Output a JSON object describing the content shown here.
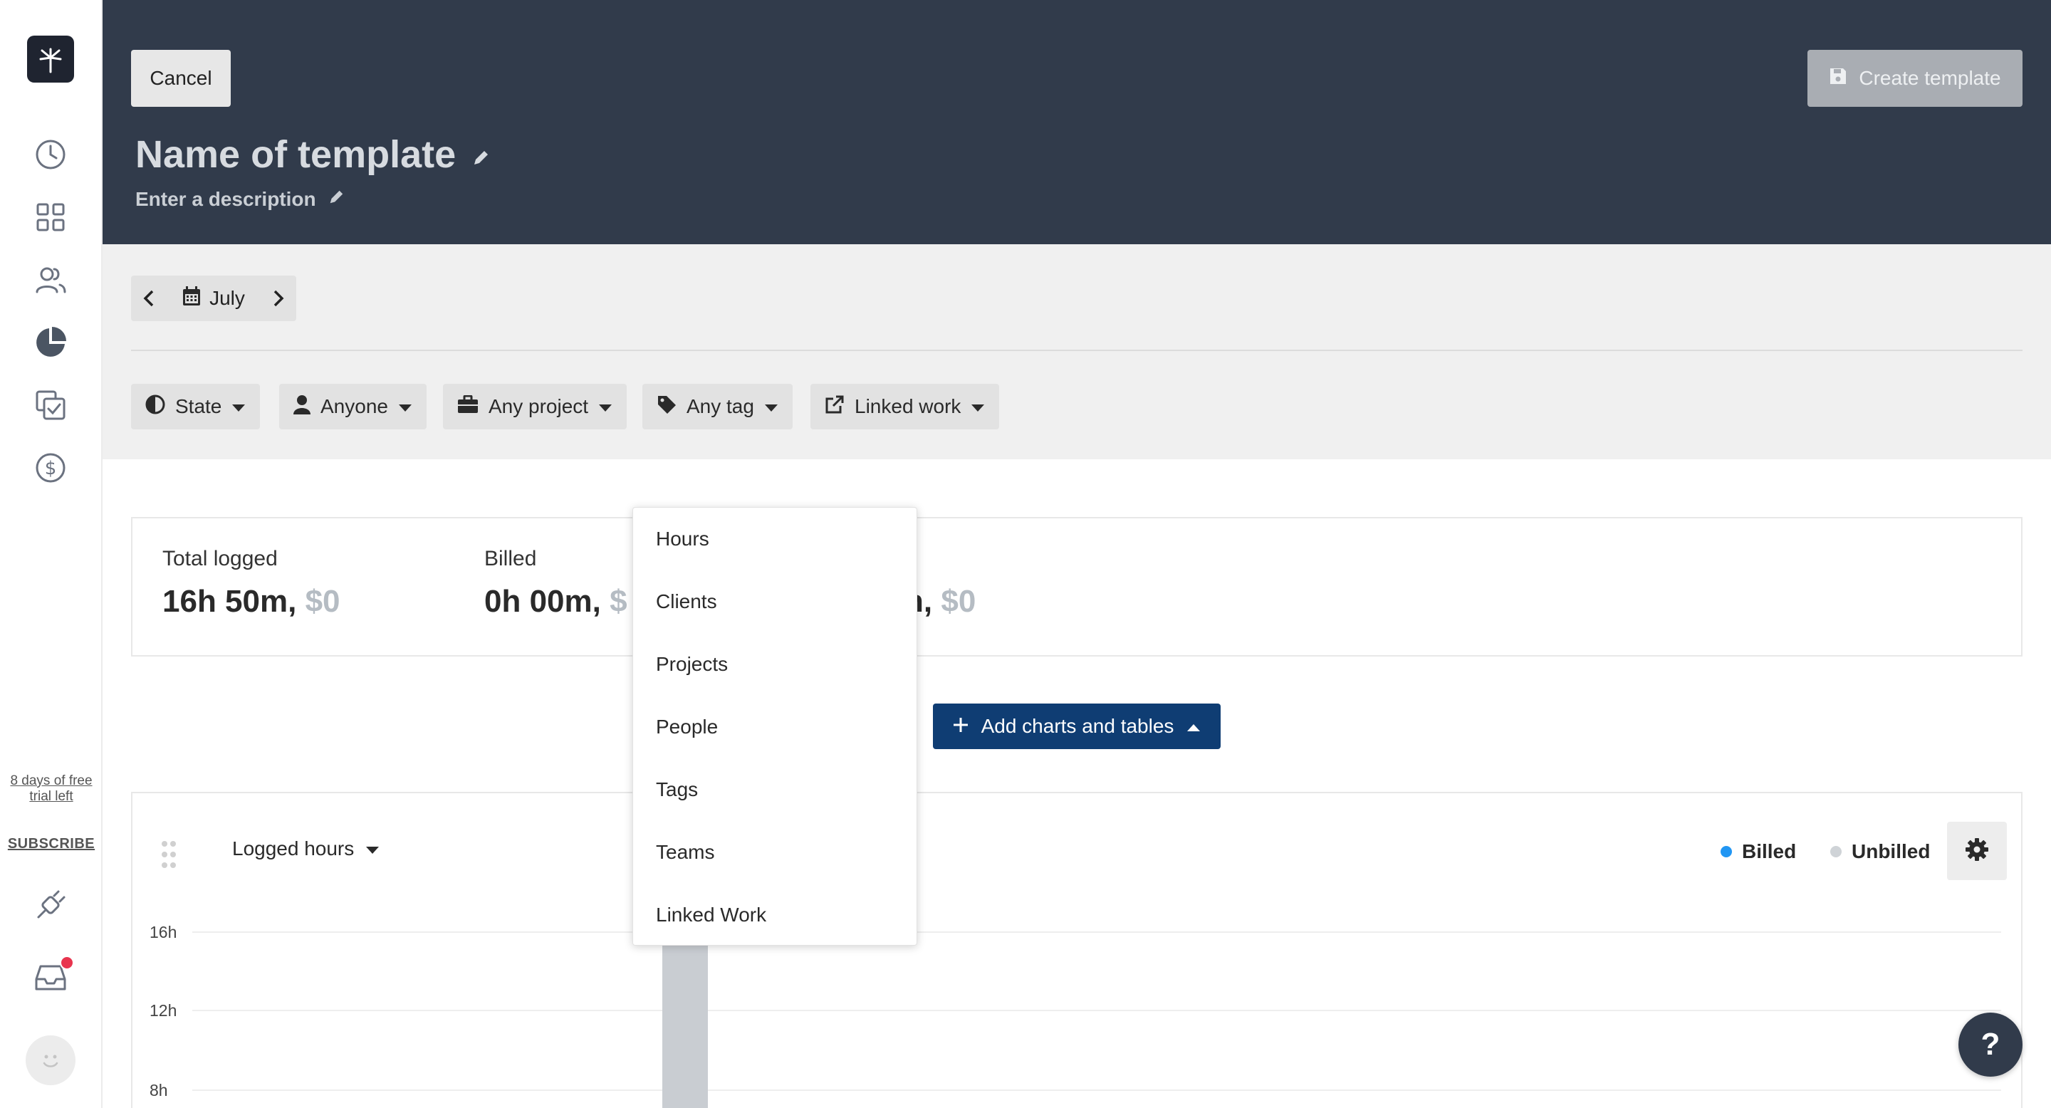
{
  "sidebar": {
    "nav_icons": [
      "clock-icon",
      "grid-icon",
      "people-icon",
      "pie-chart-icon",
      "tasks-icon",
      "dollar-icon"
    ],
    "trial_text": "8 days of free trial left",
    "subscribe_label": "SUBSCRIBE",
    "bottom_icons": [
      "plug-icon",
      "inbox-icon",
      "avatar"
    ]
  },
  "header": {
    "cancel_label": "Cancel",
    "create_label": "Create template",
    "template_name": "Name of template",
    "description_placeholder": "Enter a description"
  },
  "filters": {
    "month": "July",
    "chips": [
      {
        "label": "State",
        "icon": "half-circle-icon"
      },
      {
        "label": "Anyone",
        "icon": "person-icon"
      },
      {
        "label": "Any project",
        "icon": "briefcase-icon"
      },
      {
        "label": "Any tag",
        "icon": "tag-icon"
      },
      {
        "label": "Linked work",
        "icon": "external-link-icon"
      }
    ]
  },
  "summary": {
    "total_logged": {
      "label": "Total logged",
      "hours": "16h 50m,",
      "money": "$0"
    },
    "billed": {
      "label": "Billed",
      "hours": "0h 00m,",
      "money": "$"
    },
    "third": {
      "hours_fragment": "n,",
      "money": "$0"
    }
  },
  "add_button_label": "Add charts and tables",
  "menu": {
    "items": [
      "Hours",
      "Clients",
      "Projects",
      "People",
      "Tags",
      "Teams",
      "Linked Work"
    ]
  },
  "chart": {
    "selector_label": "Logged hours",
    "legend": [
      {
        "name": "Billed",
        "color": "#2196f3"
      },
      {
        "name": "Unbilled",
        "color": "#cfd3d7"
      }
    ],
    "yticks": [
      "16h",
      "12h",
      "8h"
    ]
  },
  "chart_data": {
    "type": "bar",
    "series": [
      {
        "name": "Unbilled",
        "values": [
          16.5
        ]
      }
    ],
    "yticks": [
      "16h",
      "12h",
      "8h"
    ]
  },
  "help_label": "?",
  "colors": {
    "header_bg": "#313b4b",
    "accent": "#0f3d73",
    "notification": "#e8344e"
  }
}
